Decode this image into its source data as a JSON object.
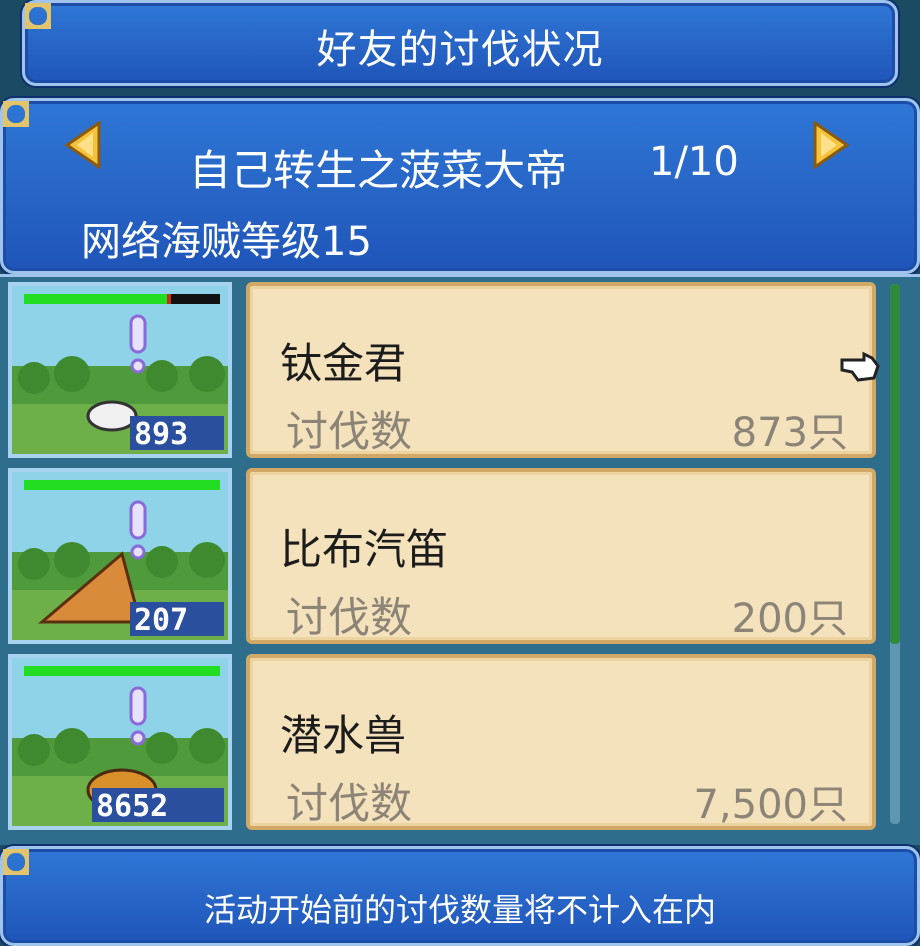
{
  "title": "好友的讨伐状况",
  "header": {
    "name": "自己转生之菠菜大帝",
    "page": "1/10",
    "level": "网络海贼等级15"
  },
  "monsters": [
    {
      "name": "钛金君",
      "label": "讨伐数",
      "count": "873只",
      "badge": "893",
      "hp_fraction": 0.73
    },
    {
      "name": "比布汽笛",
      "label": "讨伐数",
      "count": "200只",
      "badge": "207",
      "hp_fraction": 1.0
    },
    {
      "name": "潜水兽",
      "label": "讨伐数",
      "count": "7,500只",
      "badge": "8652",
      "hp_fraction": 1.0
    }
  ],
  "footer": "活动开始前的讨伐数量将不计入在内",
  "icons": [
    "arrow-left-icon",
    "arrow-right-icon",
    "pointer-hand-icon",
    "alert-icon"
  ],
  "colors": {
    "panel_blue": "#2a6ad0",
    "card_beige": "#f3e2bb",
    "hp_green": "#22dd22",
    "gold_trim": "#e2c56a"
  }
}
